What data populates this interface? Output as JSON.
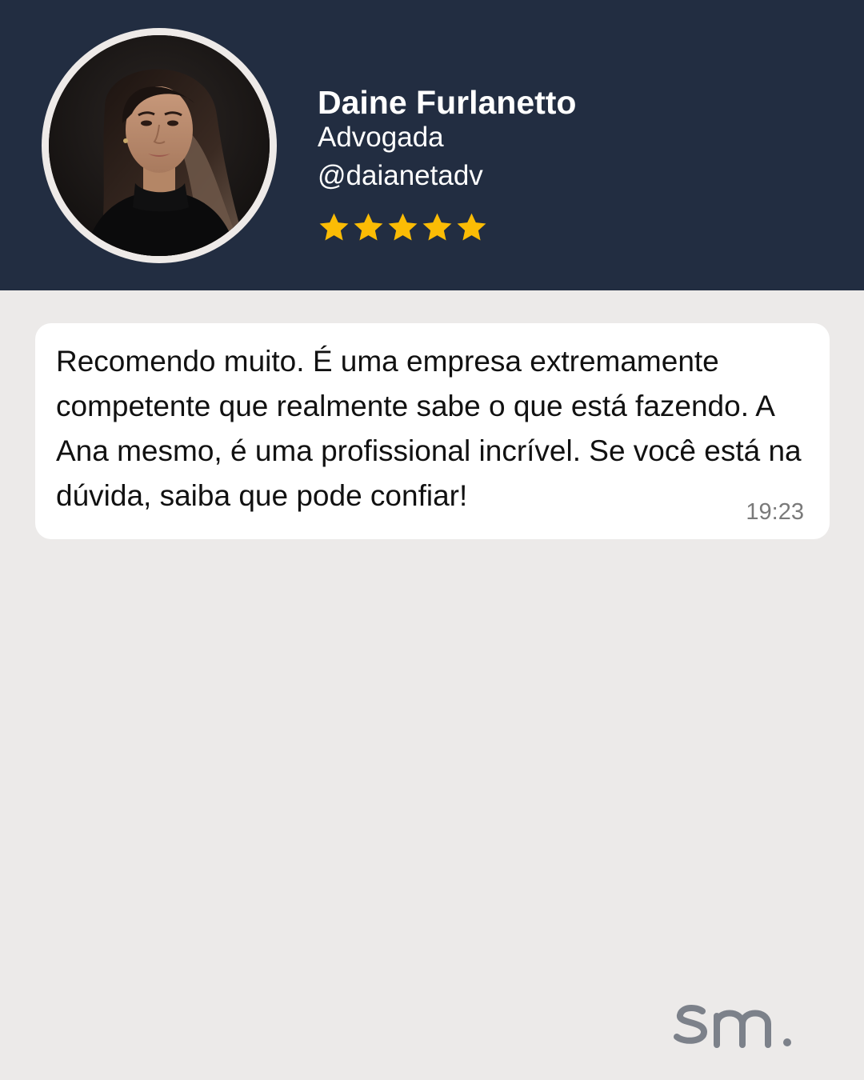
{
  "profile": {
    "name": "Daine Furlanetto",
    "role": "Advogada",
    "handle": "@daianetadv",
    "rating": 5,
    "rating_max": 5,
    "star_color": "#FBBC05",
    "photo_icon": "person-photo"
  },
  "message": {
    "text": "Recomendo muito. É uma empresa extremamente competente que realmente sabe o que está fazendo. A Ana mesmo, é uma profissional incrível. Se você está na dúvida, saiba que pode confiar!",
    "time": "19:23"
  },
  "brand": {
    "logo_text": "sm."
  },
  "colors": {
    "header_bg": "#222D41",
    "page_bg": "#ECEAE9",
    "bubble_bg": "#FFFFFF",
    "logo_color": "#7C818A"
  }
}
